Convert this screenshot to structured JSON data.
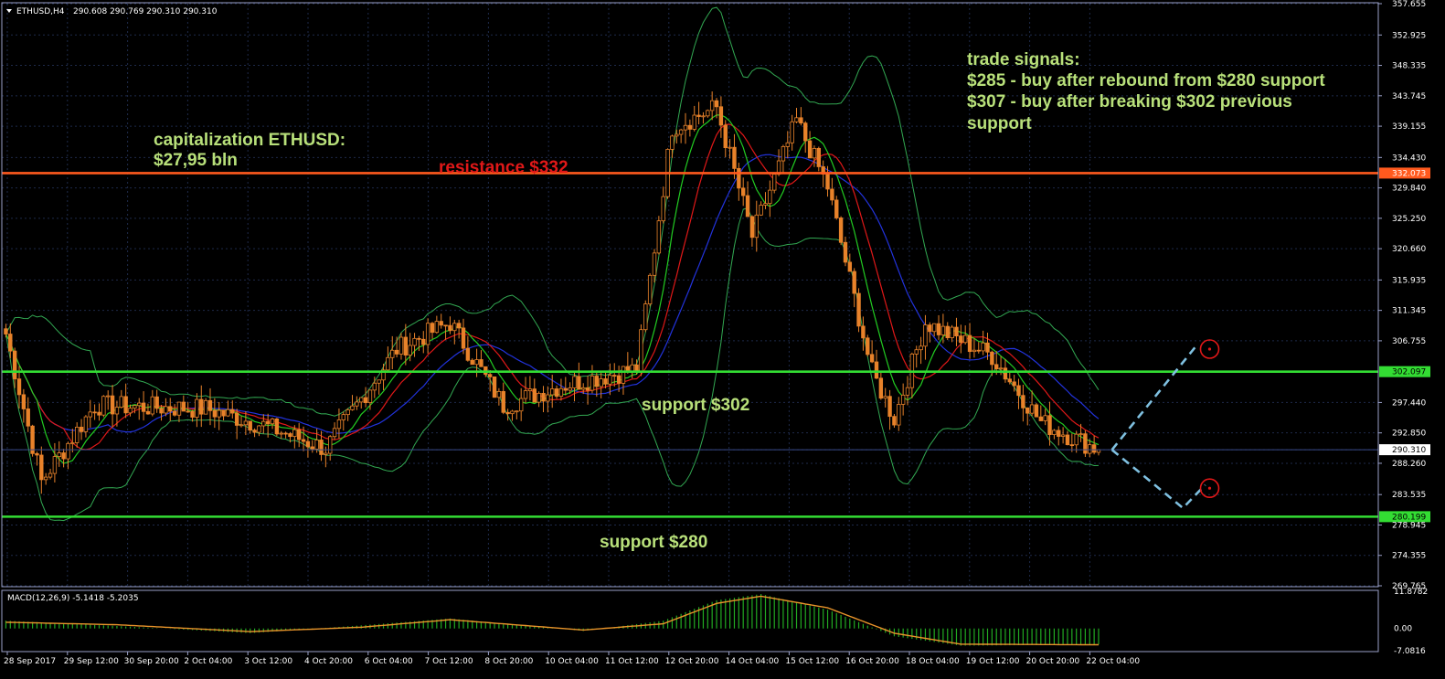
{
  "header": {
    "symbol": "ETHUSD,H4",
    "ohlc": "290.608 290.769 290.310 290.310",
    "macd_label": "MACD(12,26,9) -5.1418 -5.2035"
  },
  "colors": {
    "background": "#000000",
    "grid": "#1e2a4a",
    "frame": "#9aa0c8",
    "bull": "#000000",
    "bear": "#e8822a",
    "resistance": "#ff5a1e",
    "support": "#33dd33",
    "annotation_green": "#b8e07a",
    "annotation_red": "#e01818",
    "forecast": "#7fc0e0",
    "marker": "#e01818",
    "macd_hist": "#22aa22",
    "macd_signal": "#e8932a",
    "ma_red": "#e01818",
    "ma_green": "#22cc22",
    "ma_blue": "#2233dd",
    "bollinger": "#32a852",
    "price_tag": "#ffffff"
  },
  "annotations": {
    "capitalization_line1": "capitalization ETHUSD:",
    "capitalization_line2": "$27,95 bln",
    "resistance": "resistance $332",
    "support_302": "support $302",
    "support_280": "support $280",
    "signals_title": "trade signals:",
    "signal_1": "$285 - buy after rebound from $280 support",
    "signal_2a": "$307 - buy after breaking $302 previous",
    "signal_2b": "support"
  },
  "chart_data": [
    {
      "type": "candlestick",
      "title": "ETHUSD,H4",
      "timeframe": "H4",
      "y_ticks": [
        "357.655",
        "352.925",
        "348.335",
        "343.745",
        "339.155",
        "334.430",
        "329.840",
        "325.250",
        "320.660",
        "315.935",
        "311.345",
        "306.755",
        "302.097",
        "297.440",
        "292.850",
        "290.310",
        "288.260",
        "283.535",
        "280.199",
        "278.945",
        "274.355",
        "269.765"
      ],
      "ylim": [
        269.765,
        357.655
      ],
      "x_ticks": [
        "28 Sep 2017",
        "29 Sep 12:00",
        "30 Sep 20:00",
        "2 Oct 04:00",
        "3 Oct 12:00",
        "4 Oct 20:00",
        "6 Oct 04:00",
        "7 Oct 12:00",
        "8 Oct 20:00",
        "10 Oct 04:00",
        "11 Oct 12:00",
        "12 Oct 20:00",
        "14 Oct 04:00",
        "15 Oct 12:00",
        "16 Oct 20:00",
        "18 Oct 04:00",
        "19 Oct 12:00",
        "20 Oct 20:00",
        "22 Oct 04:00"
      ],
      "horizontal_levels": [
        {
          "label": "332.073",
          "value": 332.073,
          "kind": "resistance"
        },
        {
          "label": "302.097",
          "value": 302.097,
          "kind": "support"
        },
        {
          "label": "280.199",
          "value": 280.199,
          "kind": "support"
        }
      ],
      "current_price": {
        "label": "290.310",
        "value": 290.31
      },
      "anchors": [
        {
          "bar": 0,
          "close": 307.8
        },
        {
          "bar": 8,
          "close": 285.5
        },
        {
          "bar": 20,
          "close": 297.0
        },
        {
          "bar": 45,
          "close": 296.5
        },
        {
          "bar": 58,
          "close": 294.0
        },
        {
          "bar": 72,
          "close": 290.5
        },
        {
          "bar": 88,
          "close": 305.5
        },
        {
          "bar": 100,
          "close": 309.5
        },
        {
          "bar": 112,
          "close": 297.0
        },
        {
          "bar": 125,
          "close": 300.0
        },
        {
          "bar": 142,
          "close": 302.5
        },
        {
          "bar": 150,
          "close": 339.0
        },
        {
          "bar": 160,
          "close": 342.0
        },
        {
          "bar": 168,
          "close": 322.5
        },
        {
          "bar": 178,
          "close": 340.0
        },
        {
          "bar": 185,
          "close": 330.0
        },
        {
          "bar": 195,
          "close": 302.0
        },
        {
          "bar": 200,
          "close": 295.0
        },
        {
          "bar": 207,
          "close": 309.5
        },
        {
          "bar": 222,
          "close": 304.5
        },
        {
          "bar": 233,
          "close": 294.5
        },
        {
          "bar": 246,
          "close": 290.3
        }
      ],
      "forecast": [
        {
          "bar": 249,
          "price": 290.3
        },
        {
          "bar": 265,
          "price": 281.5
        },
        {
          "bar": 270,
          "price": 285.0
        }
      ],
      "forecast_alt": [
        {
          "bar": 249,
          "price": 290.3
        },
        {
          "bar": 268,
          "price": 306.0
        }
      ],
      "markers": [
        {
          "bar": 271,
          "price": 305.5
        },
        {
          "bar": 271,
          "price": 284.5
        }
      ]
    },
    {
      "type": "histogram",
      "title": "MACD(12,26,9) -5.1418 -5.2035",
      "y_ticks": [
        "11.8782",
        "0.00",
        "-7.0816"
      ],
      "ylim": [
        -7.0816,
        11.8782
      ],
      "segments": [
        {
          "bar": 0,
          "hist": 2.5,
          "signal": 2.0
        },
        {
          "bar": 25,
          "hist": 0.8,
          "signal": 1.2
        },
        {
          "bar": 55,
          "hist": -1.5,
          "signal": -1.0
        },
        {
          "bar": 80,
          "hist": 1.0,
          "signal": 0.4
        },
        {
          "bar": 100,
          "hist": 3.2,
          "signal": 2.8
        },
        {
          "bar": 130,
          "hist": -0.8,
          "signal": -0.5
        },
        {
          "bar": 148,
          "hist": 2.5,
          "signal": 1.5
        },
        {
          "bar": 160,
          "hist": 9.0,
          "signal": 8.0
        },
        {
          "bar": 170,
          "hist": 11.0,
          "signal": 10.3
        },
        {
          "bar": 185,
          "hist": 6.0,
          "signal": 6.6
        },
        {
          "bar": 200,
          "hist": -2.5,
          "signal": -1.5
        },
        {
          "bar": 215,
          "hist": -5.5,
          "signal": -5.0
        },
        {
          "bar": 246,
          "hist": -5.1,
          "signal": -5.2
        }
      ]
    }
  ]
}
